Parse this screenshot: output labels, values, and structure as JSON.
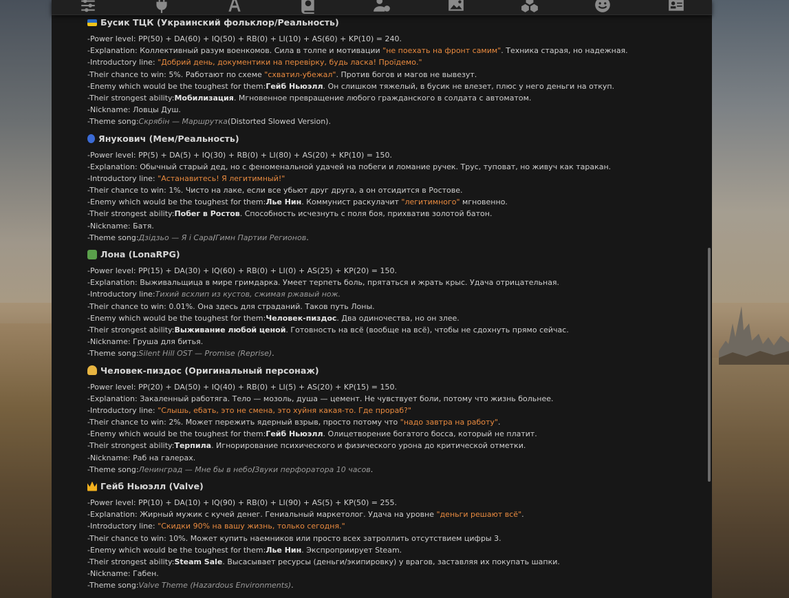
{
  "sections": [
    {
      "emoji": "ukraine-flag",
      "title": "Бусик ТЦК (Украинский фольклор/Реальность)",
      "power": "PP(50) + DA(60) + IQ(50) + RB(0) + LI(10) + AS(60) + KP(10) = 240.",
      "explanation_a": "Коллективный разум военкомов. Сила в толпе и мотивации ",
      "explanation_q": "\"не поехать на фронт самим\"",
      "explanation_b": ". Техника старая, но надежная.",
      "intro_quote": "\"Добрий день, документики на перевірку, будь ласка! Проїдемо.\"",
      "chance_a": "5%. Работают по схеме ",
      "chance_q": "\"схватил-убежал\"",
      "chance_b": ". Против богов и магов не вывезут.",
      "enemy_name": "Гейб Ньюэлл",
      "enemy_rest": ". Он слишком тяжелый, в бусик не влезет, плюс у него деньги на откуп.",
      "ability_name": "Мобилизация",
      "ability_rest": ". Мгновенное превращение любого гражданского в солдата с автоматом.",
      "nickname": "Ловцы Душ.",
      "song_it": "Скрябін — Маршрутка",
      "song_rest": "(Distorted Slowed Version)."
    },
    {
      "emoji": "runner",
      "title": "Янукович (Мем/Реальность)",
      "power": "PP(5) + DA(5) + IQ(30) + RB(0) + LI(80) + AS(20) + KP(10) = 150.",
      "explanation_a": "Обычный старый дед, но с феноменальной удачей на побеги и ломание ручек. Трус, туповат, но живуч как таракан.",
      "explanation_q": "",
      "explanation_b": "",
      "intro_quote": "\"Астанавитесь! Я легитимный!\"",
      "chance_a": "1%. Чисто на лаке, если все убьют друг друга, а он отсидится в Ростове.",
      "chance_q": "",
      "chance_b": "",
      "enemy_name": "Лье Нин",
      "enemy_rest_a": ". Коммунист раскулачит ",
      "enemy_q": "\"легитимного\"",
      "enemy_rest_b": " мгновенно.",
      "ability_name": "Побег в Ростов",
      "ability_rest": ". Способность исчезнуть с поля боя, прихватив золотой батон.",
      "nickname": "Батя.",
      "song_it": "Дзідзьо — Я і Сара",
      "song_sep": "/",
      "song_it2": "Гимн Партии Регионов",
      "song_rest": "."
    },
    {
      "emoji": "farmer",
      "title": "Лона (LonaRPG)",
      "power": "PP(15) + DA(30) + IQ(60) + RB(0) + LI(0) + AS(25) + KP(20) = 150.",
      "explanation_a": "Выживальщица в мире гримдарка. Умеет терпеть боль, прятаться и жрать крыс. Удача отрицательная.",
      "intro_it": "Тихий всхлип из кустов, сжимая ржавый нож.",
      "chance_a": "0.01%. Она здесь для страданий. Таков путь Лоны.",
      "enemy_name": "Человек-пиздос",
      "enemy_rest": ". Два одиночества, но он злее.",
      "ability_name": "Выживание любой ценой",
      "ability_rest": ". Готовность на всё (вообще на всё), чтобы не сдохнуть прямо сейчас.",
      "nickname": "Груша для битья.",
      "song_it": "Silent Hill OST — Promise (Reprise)",
      "song_rest": "."
    },
    {
      "emoji": "worker",
      "title": "Человек-пиздос (Оригинальный персонаж)",
      "power": "PP(20) + DA(50) + IQ(40) + RB(0) + LI(5) + AS(20) + KP(15) = 150.",
      "explanation_a": "Закаленный работяга. Тело — мозоль, душа — цемент. Не чувствует боли, потому что жизнь больнее.",
      "intro_quote": "\"Слышь, ебать, это не смена, это хуйня какая-то. Где прораб?\"",
      "chance_a": "2%. Может пережить ядерный взрыв, просто потому что ",
      "chance_q": "\"надо завтра на работу\"",
      "chance_b": ".",
      "enemy_name": "Гейб Ньюэлл",
      "enemy_rest": ". Олицетворение богатого босса, который не платит.",
      "ability_name": "Терпила",
      "ability_rest": ". Игнорирование психического и физического урона до критической отметки.",
      "nickname": "Раб на галерах.",
      "song_it": "Ленинград — Мне бы в небо",
      "song_sep": "/",
      "song_it2": "Звуки перфоратора 10 часов",
      "song_rest": "."
    },
    {
      "emoji": "crown",
      "title": "Гейб Ньюэлл (Valve)",
      "power": "PP(10) + DA(10) + IQ(90) + RB(0) + LI(90) + AS(5) + KP(50) = 255.",
      "explanation_a": "Жирный мужик с кучей денег. Гениальный маркетолог. Удача на уровне ",
      "explanation_q": "\"деньги решают всё\"",
      "explanation_b": ".",
      "intro_quote": "\"Скидки 90% на вашу жизнь, только сегодня.\"",
      "chance_a": "10%. Может купить наемников или просто всех затроллить отсутствием цифры 3.",
      "enemy_name": "Лье Нин",
      "enemy_rest": ". Экспроприирует Steam.",
      "ability_name": "Steam Sale",
      "ability_rest": ". Высасывает ресурсы (деньги/экипировку) у врагов, заставляя их покупать шапки.",
      "nickname": "Габен.",
      "song_it": "Valve Theme (Hazardous Environments)",
      "song_rest": "."
    }
  ],
  "labels": {
    "power": "-Power level: ",
    "explanation": "-Explanation: ",
    "intro": "-Introductory line: ",
    "intro_nospace": "-Introductory line:",
    "chance": "-Their chance to win: ",
    "enemy": "-Enemy which would be the toughest for them:",
    "ability": "-Their strongest ability:",
    "nickname": "-Nickname: ",
    "song": "-Theme song:"
  },
  "toolbar": {
    "icons": [
      "sliders-icon",
      "plug-icon",
      "font-icon",
      "book-globe-icon",
      "user-gear-icon",
      "image-icon",
      "cubes-icon",
      "smile-icon",
      "id-card-icon"
    ]
  }
}
